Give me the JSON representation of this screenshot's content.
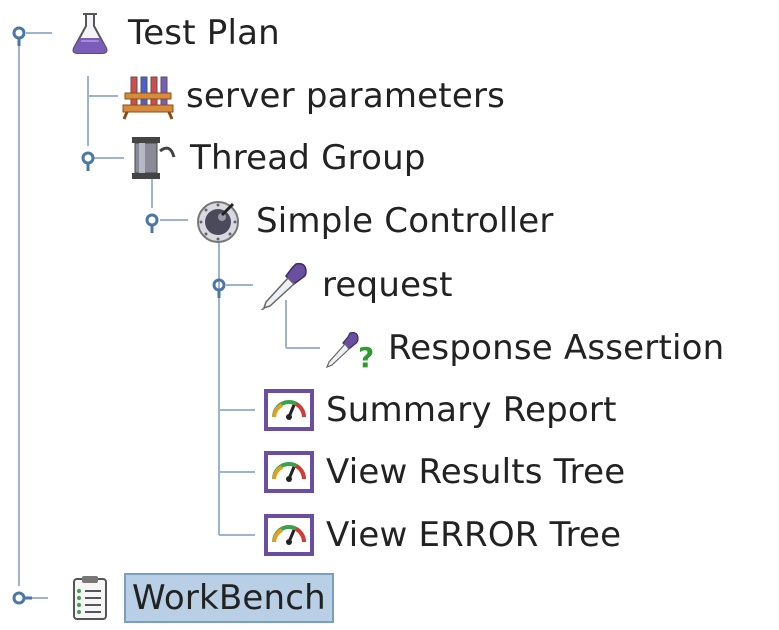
{
  "tree": {
    "nodes": [
      {
        "key": "test_plan",
        "label": "Test Plan",
        "icon": "flask-icon",
        "expanded": true
      },
      {
        "key": "server_parameters",
        "label": "server parameters",
        "icon": "test-tubes-rack-icon"
      },
      {
        "key": "thread_group",
        "label": "Thread Group",
        "icon": "spool-icon",
        "expanded": true
      },
      {
        "key": "simple_controller",
        "label": "Simple Controller",
        "icon": "controller-dial-icon",
        "expanded": true
      },
      {
        "key": "request",
        "label": "request",
        "icon": "pipette-icon",
        "expanded": true
      },
      {
        "key": "response_assertion",
        "label": "Response Assertion",
        "icon": "assertion-pipette-question-icon"
      },
      {
        "key": "summary_report",
        "label": "Summary Report",
        "icon": "gauge-report-icon"
      },
      {
        "key": "view_results_tree",
        "label": "View Results Tree",
        "icon": "gauge-report-icon"
      },
      {
        "key": "view_error_tree",
        "label": "View ERROR Tree",
        "icon": "gauge-report-icon"
      },
      {
        "key": "workbench",
        "label": "WorkBench",
        "icon": "clipboard-icon",
        "expanded": false,
        "selected": true
      }
    ]
  },
  "colors": {
    "tree_line": "#9db4d0",
    "toggle": "#4a76a8",
    "selection_bg": "#b8cfe5",
    "selection_border": "#7a9ec2",
    "purple_icon": "#6a4fa0",
    "assertion_mark": "#2f9a2f"
  }
}
